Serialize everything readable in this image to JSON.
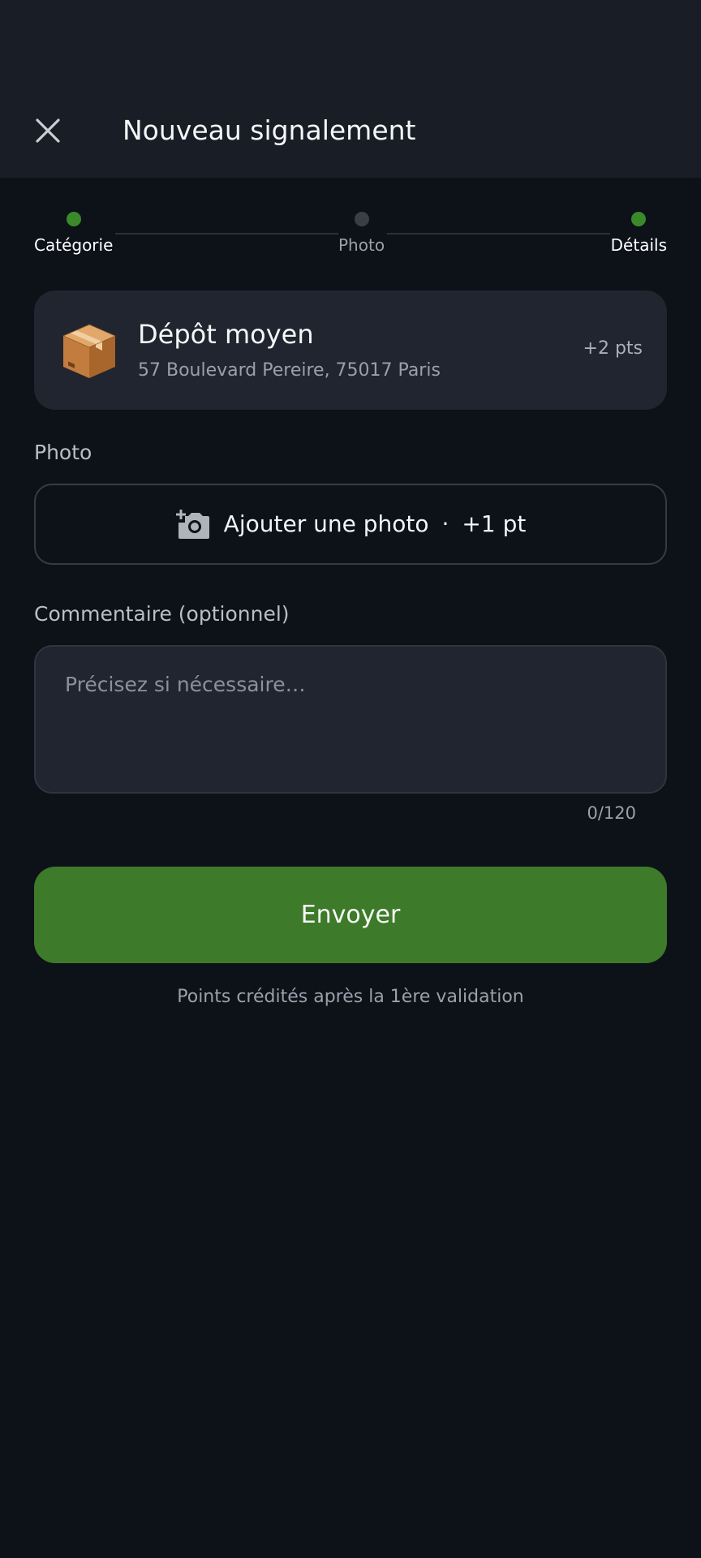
{
  "header": {
    "title": "Nouveau signalement",
    "close_icon": "close-icon"
  },
  "stepper": {
    "steps": [
      {
        "label": "Catégorie",
        "state": "done",
        "dot_color": "#3a8a2a",
        "label_color": "#ffffff"
      },
      {
        "label": "Photo",
        "state": "pending",
        "dot_color": "#3a3e47",
        "label_color": "#9aa0ab"
      },
      {
        "label": "Détails",
        "state": "current",
        "dot_color": "#3a8a2a",
        "label_color": "#ffffff"
      }
    ]
  },
  "category": {
    "icon": "package-box-icon",
    "title": "Dépôt moyen",
    "address": "57 Boulevard Pereire, 75017 Paris",
    "points": "+2 pts"
  },
  "photo": {
    "section_label": "Photo",
    "button_icon": "add-camera-icon",
    "button_label": "Ajouter une photo",
    "separator": "·",
    "button_points": "+1 pt"
  },
  "comment": {
    "section_label": "Commentaire (optionnel)",
    "placeholder": "Précisez si nécessaire…",
    "value": "",
    "char_count": "0/120"
  },
  "submit": {
    "label": "Envoyer",
    "color": "#3d7a29"
  },
  "footnote": "Points crédités après la 1ère validation",
  "colors": {
    "background": "#0d1118",
    "header_background": "#191d25",
    "card_background": "#21252f",
    "accent_green": "#3a8a2a"
  }
}
